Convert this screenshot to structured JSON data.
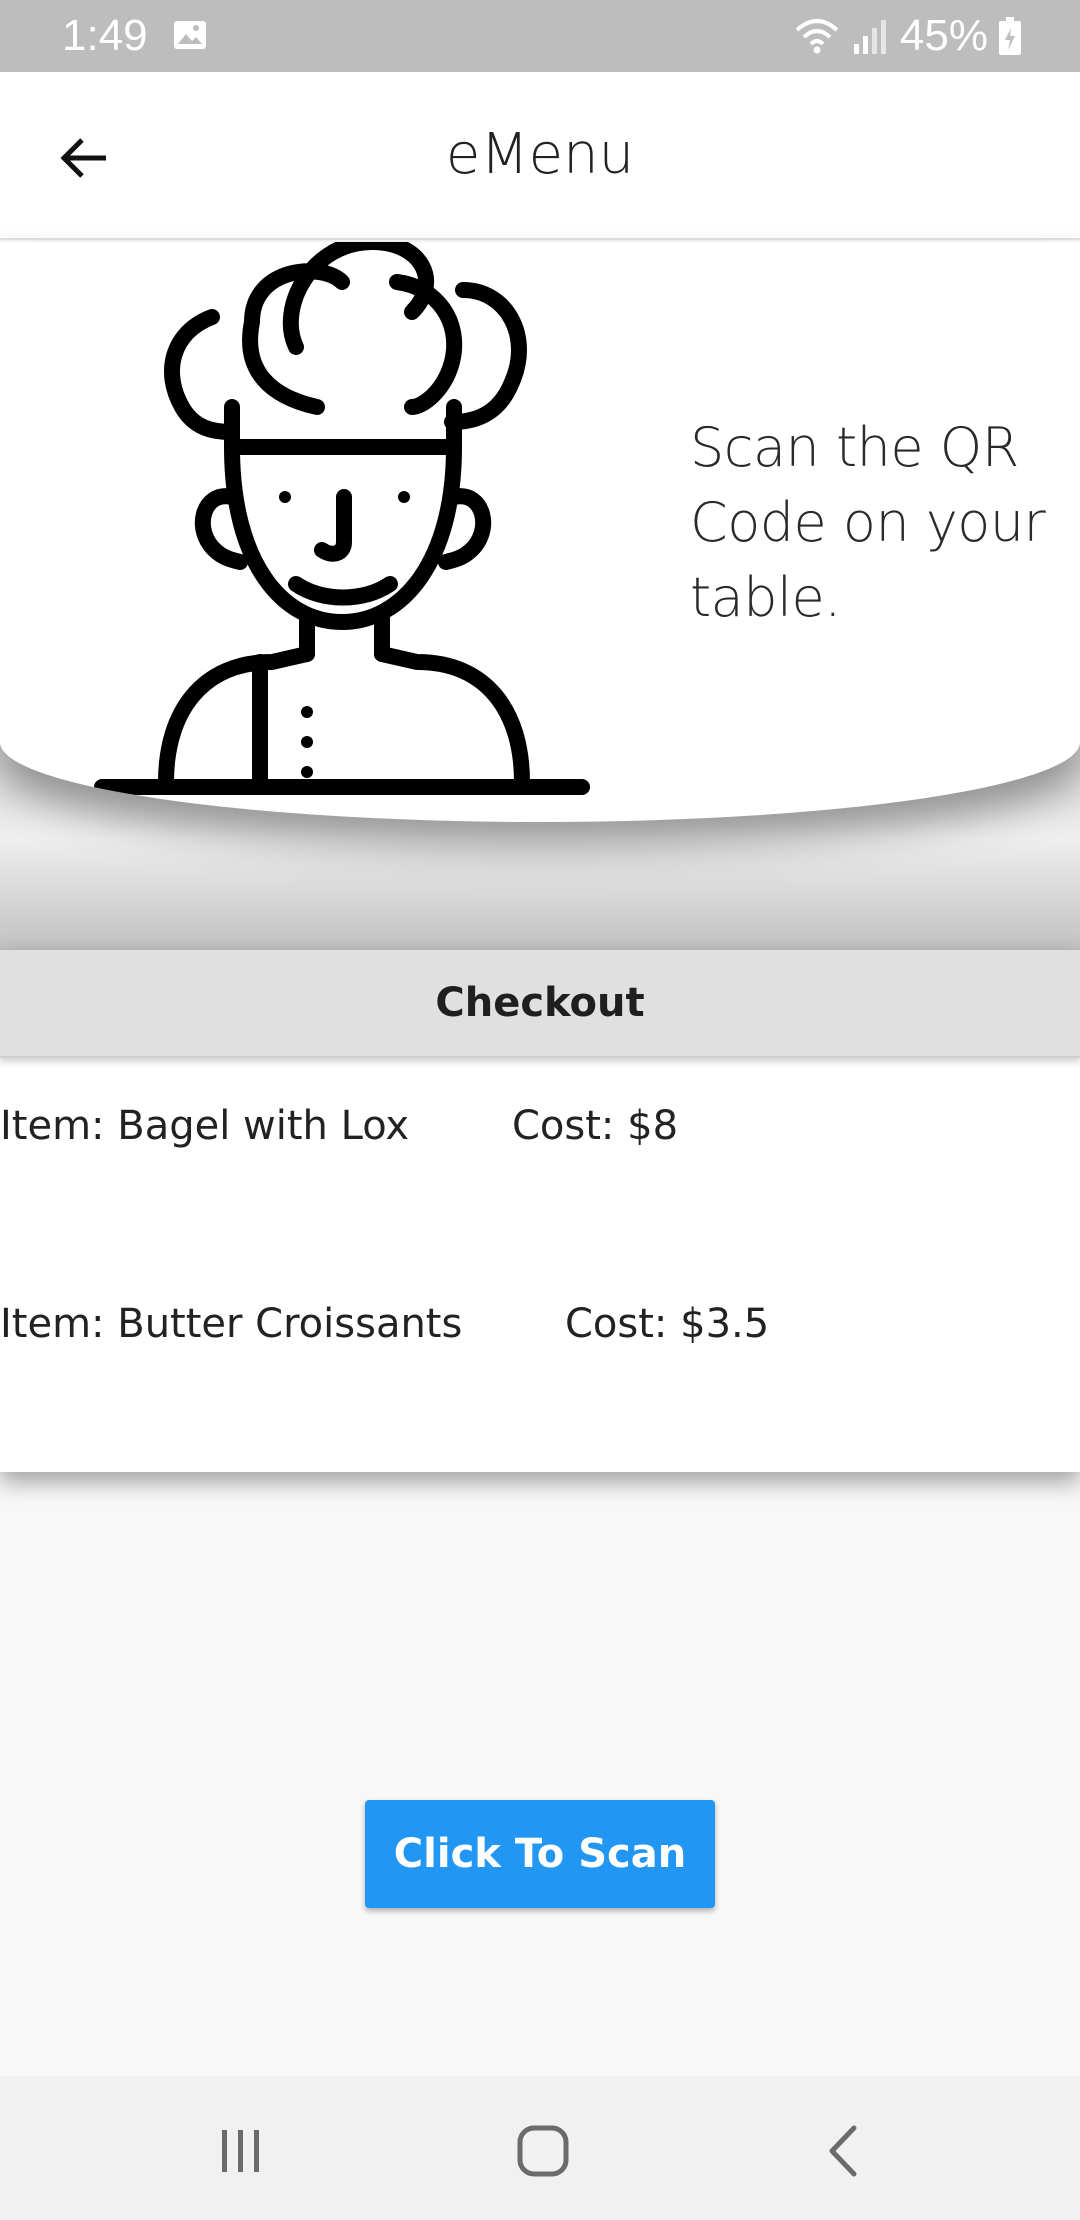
{
  "status_bar": {
    "time": "1:49",
    "battery": "45%",
    "icons": [
      "gallery-icon",
      "wifi-icon",
      "signal-icon",
      "battery-charging-icon"
    ]
  },
  "app_bar": {
    "title": "eMenu",
    "back_icon": "arrow-left-icon"
  },
  "hero": {
    "illustration": "chef-icon",
    "message": "Scan the QR Code on your table."
  },
  "checkout": {
    "title": "Checkout",
    "items": [
      {
        "name": "Item: Bagel with Lox",
        "cost": "Cost: $8"
      },
      {
        "name": "Item: Butter Croissants",
        "cost": "Cost: $3.5"
      }
    ]
  },
  "scan_button": {
    "label": "Click To Scan",
    "color": "#2196f3"
  },
  "nav_bar": {
    "icons": [
      "recent-apps-icon",
      "home-icon",
      "back-icon"
    ]
  },
  "colors": {
    "status_bar": "#bdbdbd",
    "app_bar": "#ffffff",
    "background": "#f8f8f8",
    "checkout_header": "#e0e0e0",
    "accent": "#2196f3"
  }
}
